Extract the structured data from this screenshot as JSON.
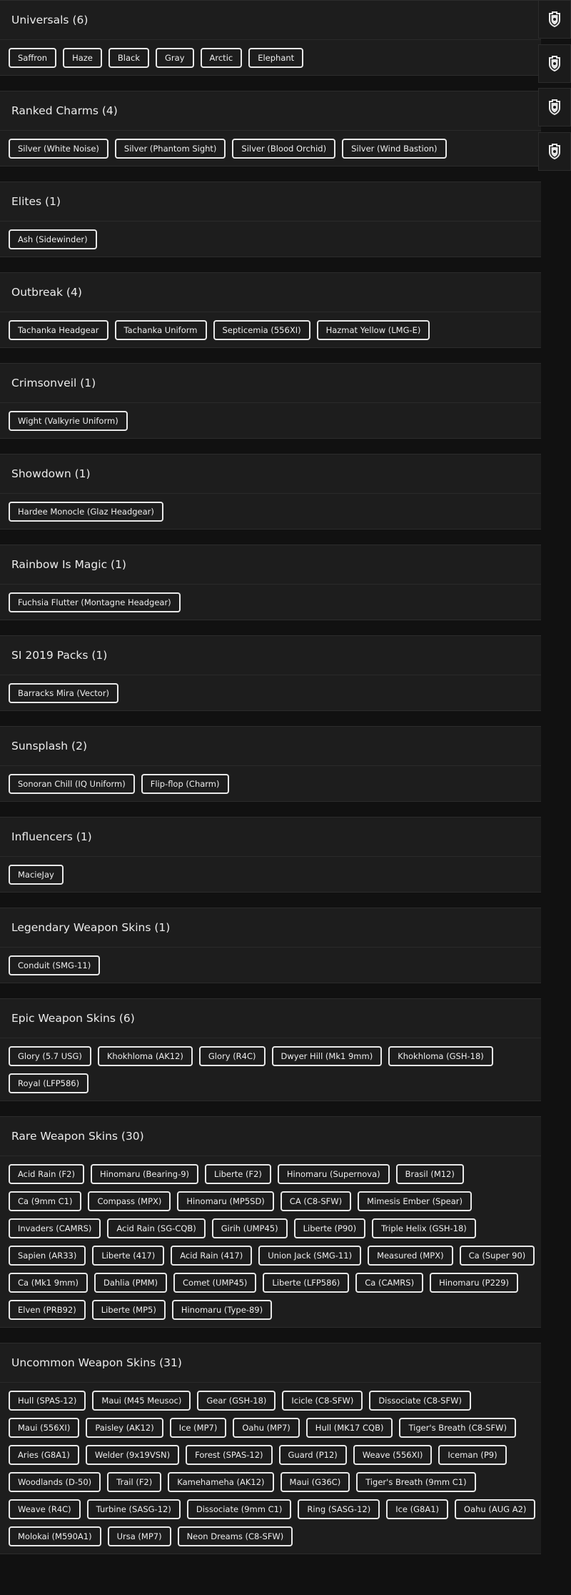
{
  "sections": [
    {
      "title": "Universals (6)",
      "items": [
        "Saffron",
        "Haze",
        "Black",
        "Gray",
        "Arctic",
        "Elephant"
      ]
    },
    {
      "title": "Ranked Charms (4)",
      "items": [
        "Silver (White Noise)",
        "Silver (Phantom Sight)",
        "Silver (Blood Orchid)",
        "Silver (Wind Bastion)"
      ]
    },
    {
      "title": "Elites (1)",
      "items": [
        "Ash (Sidewinder)"
      ]
    },
    {
      "title": "Outbreak (4)",
      "items": [
        "Tachanka Headgear",
        "Tachanka Uniform",
        "Septicemia (556XI)",
        "Hazmat Yellow (LMG-E)"
      ]
    },
    {
      "title": "Crimsonveil (1)",
      "items": [
        "Wight (Valkyrie Uniform)"
      ]
    },
    {
      "title": "Showdown (1)",
      "items": [
        "Hardee Monocle (Glaz Headgear)"
      ]
    },
    {
      "title": "Rainbow Is Magic (1)",
      "items": [
        "Fuchsia Flutter (Montagne Headgear)"
      ]
    },
    {
      "title": "SI 2019 Packs (1)",
      "items": [
        "Barracks Mira (Vector)"
      ]
    },
    {
      "title": "Sunsplash (2)",
      "items": [
        "Sonoran Chill (IQ Uniform)",
        "Flip-flop (Charm)"
      ]
    },
    {
      "title": "Influencers (1)",
      "items": [
        "MacieJay"
      ]
    },
    {
      "title": "Legendary Weapon Skins (1)",
      "items": [
        "Conduit (SMG-11)"
      ]
    },
    {
      "title": "Epic Weapon Skins (6)",
      "items": [
        "Glory (5.7 USG)",
        "Khokhloma (AK12)",
        "Glory (R4C)",
        "Dwyer Hill (Mk1 9mm)",
        "Khokhloma (GSH-18)",
        "Royal (LFP586)"
      ]
    },
    {
      "title": "Rare Weapon Skins (30)",
      "items": [
        "Acid Rain (F2)",
        "Hinomaru (Bearing-9)",
        "Liberte (F2)",
        "Hinomaru (Supernova)",
        "Brasil (M12)",
        "Ca (9mm C1)",
        "Compass (MPX)",
        "Hinomaru (MP5SD)",
        "CA (C8-SFW)",
        "Mimesis Ember (Spear)",
        "Invaders (CAMRS)",
        "Acid Rain (SG-CQB)",
        "Girih (UMP45)",
        "Liberte (P90)",
        "Triple Helix (GSH-18)",
        "Sapien (AR33)",
        "Liberte (417)",
        "Acid Rain (417)",
        "Union Jack (SMG-11)",
        "Measured (MPX)",
        "Ca (Super 90)",
        "Ca (Mk1 9mm)",
        "Dahlia (PMM)",
        "Comet (UMP45)",
        "Liberte (LFP586)",
        "Ca (CAMRS)",
        "Hinomaru (P229)",
        "Elven (PRB92)",
        "Liberte (MP5)",
        "Hinomaru (Type-89)"
      ]
    },
    {
      "title": "Uncommon Weapon Skins (31)",
      "items": [
        "Hull (SPAS-12)",
        "Maui (M45 Meusoc)",
        "Gear (GSH-18)",
        "Icicle (C8-SFW)",
        "Dissociate (C8-SFW)",
        "Maui (556XI)",
        "Paisley (AK12)",
        "Ice (MP7)",
        "Oahu (MP7)",
        "Hull (MK17 CQB)",
        "Tiger's Breath (C8-SFW)",
        "Aries (G8A1)",
        "Welder (9x19VSN)",
        "Forest (SPAS-12)",
        "Guard (P12)",
        "Weave (556XI)",
        "Iceman (P9)",
        "Woodlands (D-50)",
        "Trail (F2)",
        "Kamehameha (AK12)",
        "Maui (G36C)",
        "Tiger's Breath (9mm C1)",
        "Weave (R4C)",
        "Turbine (SASG-12)",
        "Dissociate (9mm C1)",
        "Ring (SASG-12)",
        "Ice (G8A1)",
        "Oahu (AUG A2)",
        "Molokai (M590A1)",
        "Ursa (MP7)",
        "Neon Dreams (C8-SFW)"
      ]
    }
  ],
  "side_buttons": [
    {
      "icon": "shield-badge-icon"
    },
    {
      "icon": "shield-badge-icon"
    },
    {
      "icon": "shield-badge-icon"
    },
    {
      "icon": "shield-badge-icon"
    }
  ]
}
